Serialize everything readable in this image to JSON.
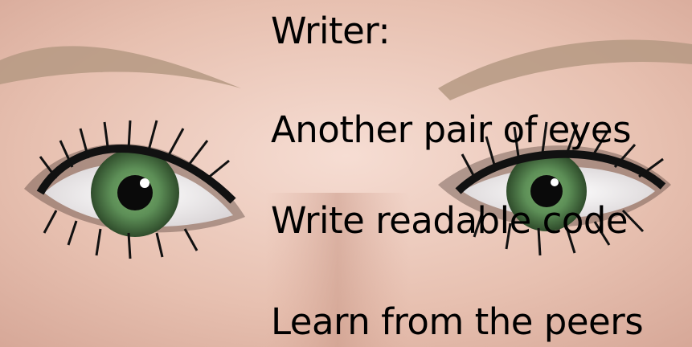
{
  "slide": {
    "lines": [
      "Writer:",
      "Another pair of eyes",
      "Write readable code",
      "Learn from the peers"
    ]
  },
  "photo": {
    "subject": "close-up-eyes",
    "colors": {
      "skin": "#e9c7b8",
      "iris": "#5d8f57",
      "brow": "#b59983",
      "lashes": "#111111"
    }
  }
}
